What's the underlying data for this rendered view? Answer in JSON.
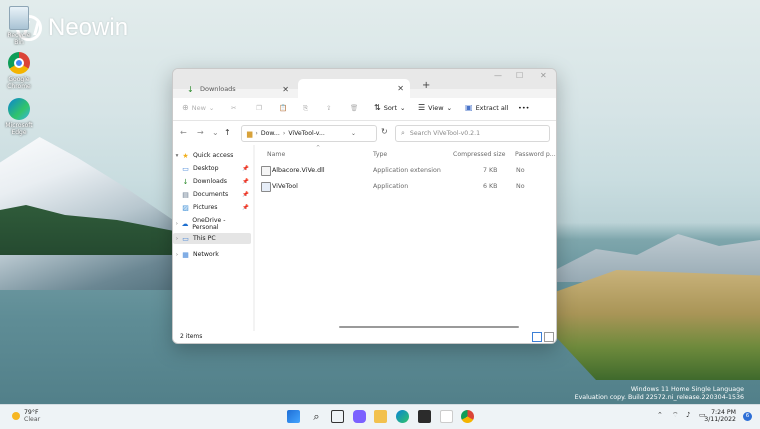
{
  "brand": {
    "name": "Neowin"
  },
  "desktop_icons": [
    {
      "label": "Recycle Bin",
      "icon": "recycle-bin-icon"
    },
    {
      "label": "Google Chrome",
      "icon": "chrome-icon"
    },
    {
      "label": "Microsoft Edge",
      "icon": "edge-icon"
    }
  ],
  "window": {
    "tabs": [
      {
        "label": "Downloads",
        "close": "✕"
      },
      {
        "label": "",
        "close": "✕"
      }
    ],
    "new_tab": "+",
    "controls": {
      "minimize": "—",
      "maximize": "☐",
      "close": "✕"
    },
    "toolbar": {
      "new_label": "New",
      "sort_label": "Sort",
      "view_label": "View",
      "extract_label": "Extract all",
      "more": "•••"
    },
    "address": {
      "path_root": "Dow...",
      "path_current": "ViVeTool-v...",
      "search_placeholder": "Search ViVeTool-v0.2.1"
    },
    "sidebar": [
      {
        "label": "Quick access",
        "icon": "star-icon",
        "chevron": "▾",
        "pinned": false,
        "indent": 0
      },
      {
        "label": "Desktop",
        "icon": "desktop-icon",
        "chevron": "",
        "pinned": true,
        "indent": 1
      },
      {
        "label": "Downloads",
        "icon": "download-icon",
        "chevron": "",
        "pinned": true,
        "indent": 1
      },
      {
        "label": "Documents",
        "icon": "document-icon",
        "chevron": "",
        "pinned": true,
        "indent": 1
      },
      {
        "label": "Pictures",
        "icon": "pictures-icon",
        "chevron": "",
        "pinned": true,
        "indent": 1
      },
      {
        "label": "OneDrive - Personal",
        "icon": "cloud-icon",
        "chevron": "›",
        "pinned": false,
        "indent": 0
      },
      {
        "label": "This PC",
        "icon": "pc-icon",
        "chevron": "›",
        "pinned": false,
        "indent": 0,
        "selected": true
      },
      {
        "label": "Network",
        "icon": "network-icon",
        "chevron": "›",
        "pinned": false,
        "indent": 0
      }
    ],
    "columns": {
      "name": "Name",
      "type": "Type",
      "size": "Compressed size",
      "password": "Password p..."
    },
    "files": [
      {
        "name": "Albacore.ViVe.dll",
        "type": "Application extension",
        "size": "7 KB",
        "password": "No"
      },
      {
        "name": "ViVeTool",
        "type": "Application",
        "size": "6 KB",
        "password": "No"
      }
    ],
    "status": {
      "items": "2 items"
    }
  },
  "watermark": {
    "line1": "Windows 11 Home Single Language",
    "line2": "Evaluation copy. Build 22572.ni_release.220304-1536"
  },
  "taskbar": {
    "weather": {
      "temp": "79°F",
      "condition": "Clear"
    },
    "clock": {
      "time": "7:24 PM",
      "date": "3/11/2022"
    },
    "notifications": "6"
  }
}
